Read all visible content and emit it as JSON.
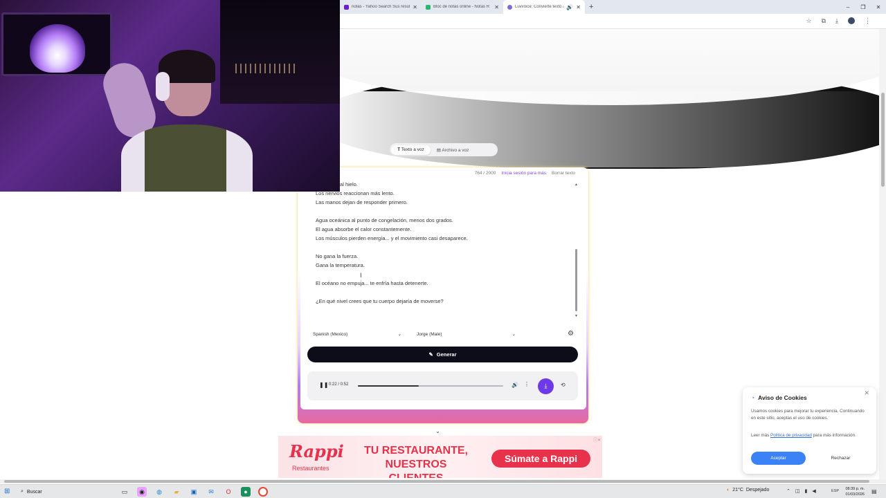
{
  "browser": {
    "tabs": [
      {
        "title": "notas - Yahoo Search Sus result",
        "favicon_color": "#6a1fd1",
        "active": false
      },
      {
        "title": "Bloc de notas online - Notas R",
        "favicon_color": "#2bb673",
        "active": false
      },
      {
        "title": "Luvvoice: Convierte texto a",
        "favicon_color": "#7a6cd9",
        "active": true
      }
    ],
    "new_tab": "+",
    "window_controls": [
      "–",
      "❐",
      "✕"
    ]
  },
  "mode_tabs": [
    {
      "label": "Texto a voz",
      "active": true
    },
    {
      "label": "Archivo a voz",
      "active": false
    }
  ],
  "editor": {
    "char_count": "764 / 2000",
    "login_link": "Inicia sesión para más",
    "clear_label": "Borrar texto",
    "lines": [
      "a cercana al hielo.",
      "Los nervios reaccionan más lento.",
      "Las manos dejan de responder primero.",
      "",
      "Agua oceánica al punto de congelación, menos dos grados.",
      "El agua absorbe el calor constantemente.",
      "Los músculos pierden energía... y el movimiento casi desaparece.",
      "",
      "No gana la fuerza.",
      "Gana la temperatura.",
      "",
      "El océano no empuja... te enfría hasta detenerte.",
      "",
      "¿En qué nivel crees que tu cuerpo dejaría de moverse?"
    ]
  },
  "language_select": "Spanish (Mexico)",
  "voice_select": "Jorge (Male)",
  "generate_label": "Generar",
  "player": {
    "time": "0:22 / 0:52",
    "progress": 0.42
  },
  "ad": {
    "brand": "Rappi",
    "brand_sub": "Restaurantes",
    "headline_1": "TU RESTAURANTE,",
    "headline_2": "NUESTROS CLIENTES",
    "cta": "Súmate a Rappi"
  },
  "cookies": {
    "title": "Aviso de Cookies",
    "body": "Usamos cookies para mejorar tu experiencia. Continuando en este sitio, aceptas el uso de cookies.",
    "more_prefix": "Leer más",
    "policy_link": "Política de privacidad",
    "more_suffix": "para más información.",
    "accept": "Aceptar",
    "reject": "Rechazar"
  },
  "taskbar": {
    "search": "Buscar",
    "temperature": "21°C",
    "weather": "Despejado",
    "language": "ESP",
    "time": "08:39 p. m.",
    "date": "01/03/2026"
  },
  "colors": {
    "accent_purple": "#6d3ae8",
    "generate_bg": "#0d0d1a",
    "rappi_red": "#e8324b",
    "cookie_accept": "#3b82f6"
  }
}
